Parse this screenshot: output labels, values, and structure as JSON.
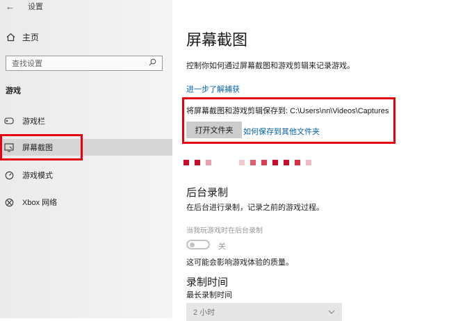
{
  "window": {
    "back_glyph": "←",
    "title": "设置"
  },
  "sidebar": {
    "home_label": "主页",
    "search_placeholder": "查找设置",
    "section_title": "游戏",
    "items": [
      {
        "label": "游戏栏",
        "icon": "game-bar-icon"
      },
      {
        "label": "屏幕截图",
        "icon": "screenshot-icon",
        "selected": true
      },
      {
        "label": "游戏模式",
        "icon": "game-mode-icon"
      },
      {
        "label": "Xbox 网络",
        "icon": "xbox-icon"
      }
    ]
  },
  "main": {
    "title": "屏幕截图",
    "description": "控制你如何通过屏幕截图和游戏剪辑来记录游戏。",
    "learn_more": "进一步了解捕获",
    "save_path_text": "将屏幕截图和游戏剪辑保存到: C:\\Users\\nn\\Videos\\Captures",
    "open_folder_button": "打开文件夹",
    "save_other_link": "如何保存到其他文件夹",
    "background_recording": {
      "title": "后台录制",
      "description": "在后台进行录制，记录之前的游戏过程。",
      "toggle_caption": "当我玩游戏时在后台录制",
      "toggle_state": "关",
      "toggle_on": false,
      "note": "这可能会影响游戏体验的质量。"
    },
    "record_time": {
      "title": "录制时间",
      "label": "最长录制时间",
      "value": "2 小时"
    }
  },
  "colors": {
    "accent_link": "#0063b1",
    "highlight_red": "#e60012",
    "pixel_marks": [
      "#c8102e",
      "#c8102e",
      "#e8a0aa",
      "#f2c8ce",
      "#e06070",
      "#d84050",
      "#c8102e",
      "#c8102e",
      "#d83040",
      "#f0b8c0"
    ]
  }
}
